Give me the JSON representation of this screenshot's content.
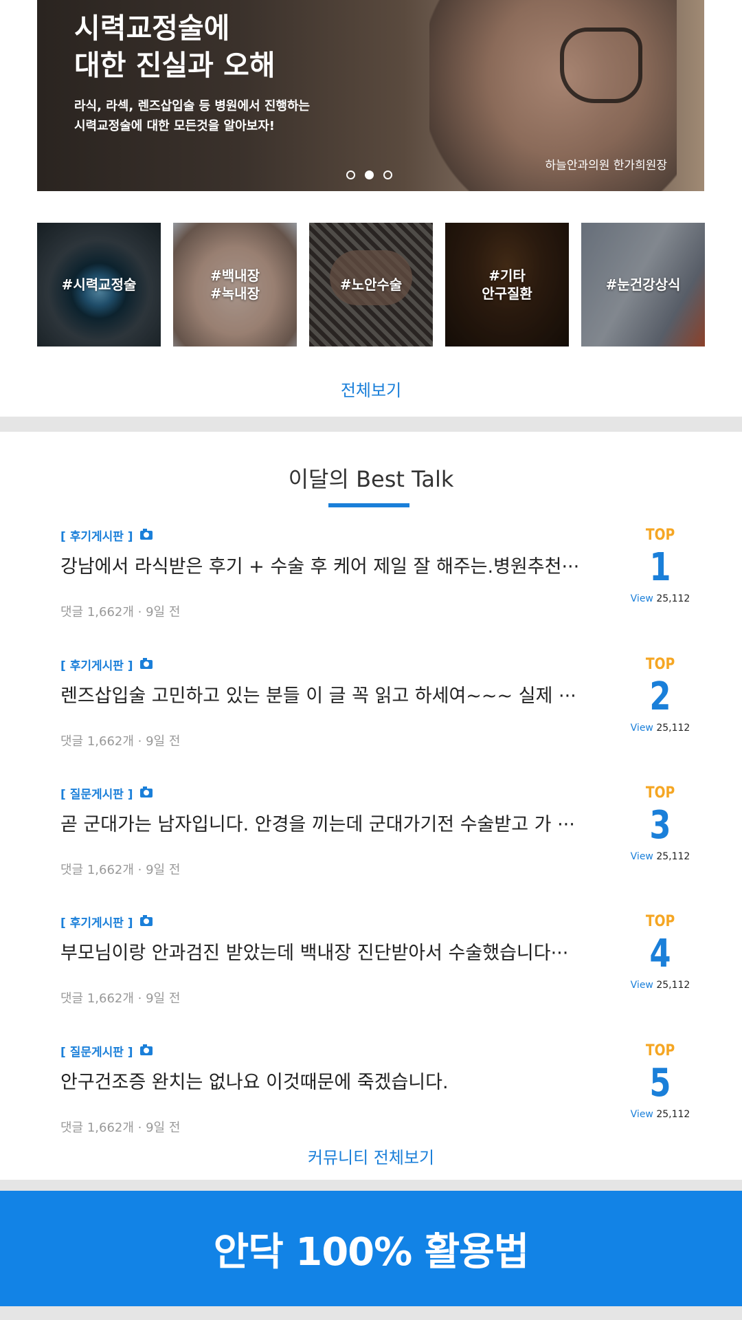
{
  "hero": {
    "title": "시력교정술에\n대한 진실과 오해",
    "subtitle": "라식, 라섹, 렌즈삽입술 등 병원에서 진행하는\n시력교정술에 대한 모든것을 알아보자!",
    "credit": "하늘안과의원 한가희원장",
    "slides_total": 3,
    "active_slide": 2
  },
  "categories": [
    {
      "label": "#시력교정술"
    },
    {
      "label": "#백내장\n#녹내장"
    },
    {
      "label": "#노안수술"
    },
    {
      "label": "#기타\n안구질환"
    },
    {
      "label": "#눈건강상식"
    }
  ],
  "see_all": "전체보기",
  "best_talk": {
    "title": "이달의 Best Talk",
    "posts": [
      {
        "board": "[ 후기게시판 ]",
        "title": "강남에서 라식받은 후기 + 수술 후 케어 제일 잘 해주는.병원추천···",
        "meta": "댓글 1,662개 · 9일 전",
        "top_label": "TOP",
        "rank": "1",
        "view_label": "View",
        "views": "25,112"
      },
      {
        "board": "[ 후기게시판 ]",
        "title": "렌즈삽입술 고민하고 있는 분들 이 글 꼭 읽고 하세여~~~ 실제 ···",
        "meta": "댓글 1,662개 · 9일 전",
        "top_label": "TOP",
        "rank": "2",
        "view_label": "View",
        "views": "25,112"
      },
      {
        "board": "[ 질문게시판 ]",
        "title": "곧 군대가는 남자입니다. 안경을 끼는데 군대가기전 수술받고 가 ···",
        "meta": "댓글 1,662개 · 9일 전",
        "top_label": "TOP",
        "rank": "3",
        "view_label": "View",
        "views": "25,112"
      },
      {
        "board": "[ 후기게시판 ]",
        "title": "부모님이랑 안과검진 받았는데 백내장 진단받아서 수술했습니다···",
        "meta": "댓글 1,662개 · 9일 전",
        "top_label": "TOP",
        "rank": "4",
        "view_label": "View",
        "views": "25,112"
      },
      {
        "board": "[ 질문게시판 ]",
        "title": "안구건조증 완치는 없나요 이것때문에 죽겠습니다.",
        "meta": "댓글 1,662개 · 9일 전",
        "top_label": "TOP",
        "rank": "5",
        "view_label": "View",
        "views": "25,112"
      }
    ]
  },
  "community_all": "커뮤니티 전체보기",
  "banner": "안닥 100% 활용법",
  "colors": {
    "accent": "#1a7fd9",
    "top_label": "#f5a623",
    "banner_bg": "#1283e6"
  }
}
